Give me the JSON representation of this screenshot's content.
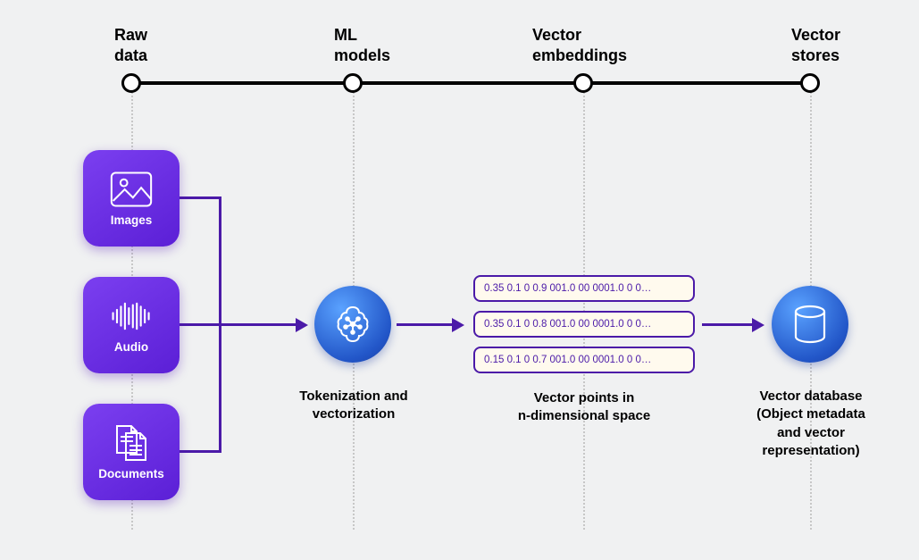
{
  "timeline": {
    "labels": [
      "Raw\ndata",
      "ML\nmodels",
      "Vector\nembeddings",
      "Vector\nstores"
    ]
  },
  "cards": {
    "images": "Images",
    "audio": "Audio",
    "documents": "Documents"
  },
  "mlLabel": "Tokenization and\nvectorization",
  "embeddings": {
    "rows": [
      "0.35 0.1 0 0.9 001.0 00 0001.0 0 0…",
      "0.35 0.1 0 0.8 001.0 00 0001.0 0 0…",
      "0.15 0.1 0 0.7 001.0 00 0001.0 0 0…"
    ],
    "label": "Vector points in\nn-dimensional space"
  },
  "storeLabel": "Vector database\n(Object metadata\nand vector\nrepresentation)"
}
